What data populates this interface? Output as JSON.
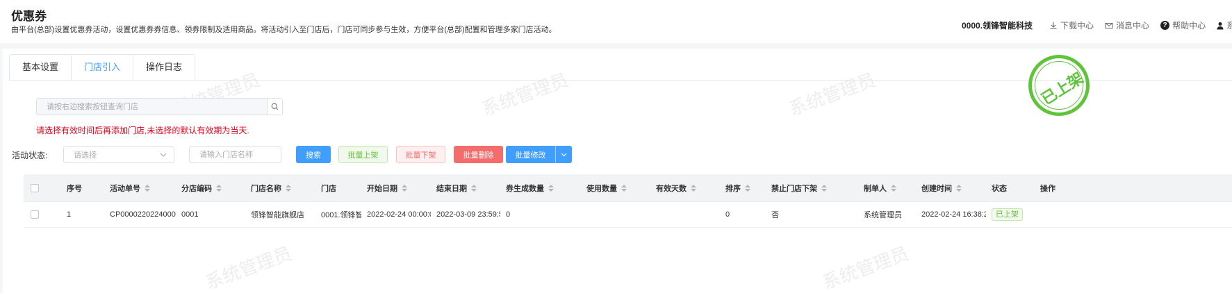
{
  "header": {
    "title": "优惠券",
    "description": "由平台(总部)设置优惠券活动，设置优惠券券信息、领券限制及适用商品。将活动引入至门店后，门店可同步参与生效，方便平台(总部)配置和管理多家门店活动。",
    "company": "0000.领锋智能科技",
    "links": {
      "download": "下载中心",
      "message": "消息中心",
      "help": "帮助中心",
      "user": "系"
    }
  },
  "tabs": [
    {
      "label": "基本设置",
      "active": false
    },
    {
      "label": "门店引入",
      "active": true
    },
    {
      "label": "操作日志",
      "active": false
    }
  ],
  "watermark_text": "系统管理员",
  "stamp_text": "已上架",
  "store_search": {
    "placeholder": "请按右边搜索按钮查询门店"
  },
  "warning": "请选择有效时间后再添加门店,未选择的默认有效期为当天.",
  "filters": {
    "status_label": "活动状态:",
    "status_placeholder": "请选择",
    "store_name_placeholder": "请输入门店名称"
  },
  "buttons": {
    "search": "搜索",
    "batch_up": "批量上架",
    "batch_down": "批量下架",
    "batch_delete": "批量删除",
    "batch_edit": "批量修改"
  },
  "colors": {
    "primary": "#409eff",
    "success": "#67c23a",
    "danger": "#f56c6c",
    "warning_text": "#e6001a",
    "stamp": "#5fc43b"
  },
  "table": {
    "columns": {
      "seq": "序号",
      "activity_no": "活动单号",
      "branch_code": "分店编码",
      "store_name": "门店名称",
      "store": "门店",
      "start_date": "开始日期",
      "end_date": "结束日期",
      "coupons_generated": "券生成数量",
      "used_count": "使用数量",
      "valid_days": "有效天数",
      "sort": "排序",
      "forbid_store_off": "禁止门店下架",
      "creator": "制单人",
      "created_at": "创建时间",
      "status": "状态",
      "action": "操作"
    },
    "rows": [
      {
        "seq": "1",
        "activity_no": "CP0000220224000",
        "branch_code": "0001",
        "store_name": "领锋智能旗舰店",
        "store": "0001.领锋智",
        "start_date": "2022-02-24 00:00:0",
        "end_date": "2022-03-09 23:59:5",
        "coupons_generated": "0",
        "used_count": "",
        "valid_days": "",
        "sort": "0",
        "forbid_store_off": "否",
        "creator": "系统管理员",
        "created_at": "2022-02-24 16:38:2",
        "status": "已上架",
        "action": ""
      }
    ]
  }
}
